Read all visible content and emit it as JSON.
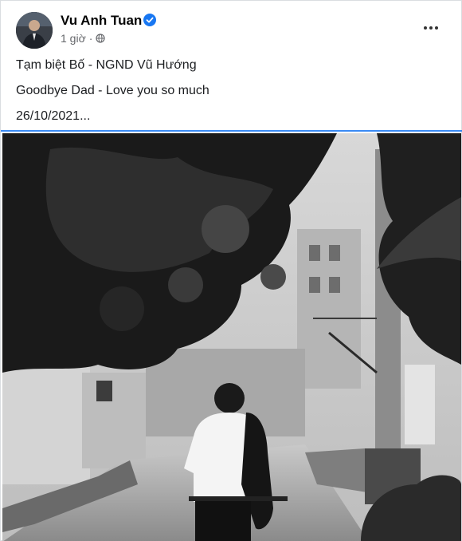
{
  "post": {
    "author": "Vu Anh Tuan",
    "time": "1 giờ",
    "privacy_icon": "globe-icon",
    "verified_icon": "verified-badge-icon",
    "more_icon": "more-options-icon",
    "caption_lines": [
      "Tạm biệt Bố - NGND Vũ Hướng",
      "Goodbye Dad - Love you so much",
      "26/10/2021..."
    ]
  },
  "colors": {
    "accent": "#1877f2",
    "meta_text": "#65676b"
  }
}
